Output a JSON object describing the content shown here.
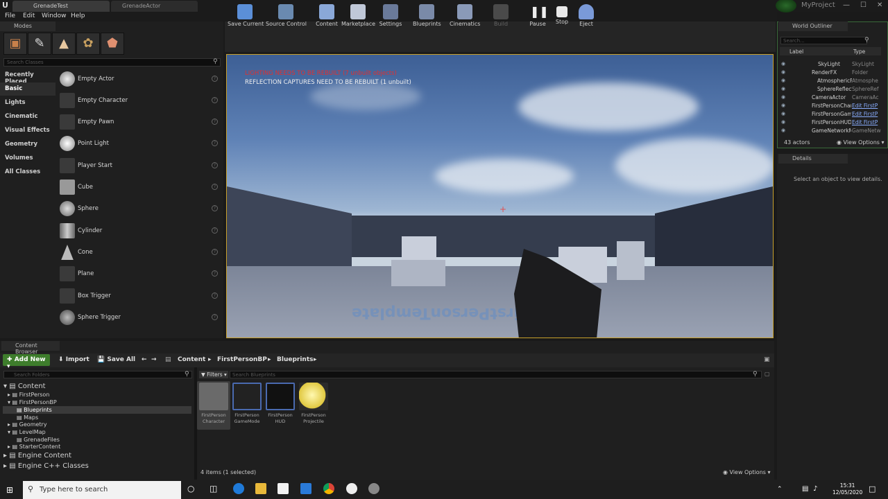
{
  "titlebar": {
    "tabs": [
      "GrenadeTest",
      "GrenadeActor"
    ],
    "project": "MyProject",
    "controls": [
      "—",
      "☐",
      "✕"
    ]
  },
  "menu": [
    "File",
    "Edit",
    "Window",
    "Help"
  ],
  "modes": {
    "header": "Modes",
    "search_placeholder": "Search Classes",
    "categories": [
      "Recently Placed",
      "Basic",
      "Lights",
      "Cinematic",
      "Visual Effects",
      "Geometry",
      "Volumes",
      "All Classes"
    ],
    "selected_category": "Basic",
    "actors": [
      "Empty Actor",
      "Empty Character",
      "Empty Pawn",
      "Point Light",
      "Player Start",
      "Cube",
      "Sphere",
      "Cylinder",
      "Cone",
      "Plane",
      "Box Trigger",
      "Sphere Trigger"
    ]
  },
  "toolbar": {
    "buttons": [
      "Save Current",
      "Source Control",
      "Content",
      "Marketplace",
      "Settings",
      "Blueprints",
      "Cinematics",
      "Build",
      "Pause",
      "Stop",
      "Eject"
    ]
  },
  "viewport": {
    "warning_lighting": "LIGHTING NEEDS TO BE REBUILT (7 unbuilt objects)",
    "warning_reflection": "REFLECTION CAPTURES NEED TO BE REBUILT (1 unbuilt)",
    "floor_text": "FirstPersonTemplate"
  },
  "outliner": {
    "header": "World Outliner",
    "search_placeholder": "Search...",
    "col_label": "Label",
    "col_type": "Type",
    "rows": [
      {
        "name": "SkyLight",
        "type": "SkyLight",
        "link": false
      },
      {
        "name": "RenderFX",
        "type": "Folder",
        "link": false
      },
      {
        "name": "AtmosphericFog",
        "type": "Atmosphe",
        "link": false
      },
      {
        "name": "SphereReflection",
        "type": "SphereRef",
        "link": false
      },
      {
        "name": "CameraActor",
        "type": "CameraAc",
        "link": false
      },
      {
        "name": "FirstPersonCharacter",
        "type": "Edit FirstP",
        "link": true
      },
      {
        "name": "FirstPersonGameMode",
        "type": "Edit FirstP",
        "link": true
      },
      {
        "name": "FirstPersonHUD",
        "type": "Edit FirstP",
        "link": true
      },
      {
        "name": "GameNetworkManager",
        "type": "GameNetw",
        "link": false
      }
    ],
    "count": "43 actors",
    "view_options": "View Options"
  },
  "details": {
    "header": "Details",
    "empty_text": "Select an object to view details."
  },
  "content_browser": {
    "header": "Content Browser",
    "add_new": "Add New",
    "import": "Import",
    "save_all": "Save All",
    "breadcrumb": [
      "Content",
      "FirstPersonBP",
      "Blueprints"
    ],
    "folder_search": "Search Folders",
    "filters": "Filters",
    "asset_search": "Search Blueprints",
    "tree": [
      {
        "label": "Content",
        "big": true
      },
      {
        "label": "FirstPerson",
        "big": false
      },
      {
        "label": "FirstPersonBP",
        "big": false
      },
      {
        "label": "Blueprints",
        "big": false
      },
      {
        "label": "Maps",
        "big": false
      },
      {
        "label": "Geometry",
        "big": false
      },
      {
        "label": "LevelMap",
        "big": false
      },
      {
        "label": "GrenadeFiles",
        "big": false
      },
      {
        "label": "StarterContent",
        "big": false
      },
      {
        "label": "Engine Content",
        "big": true
      },
      {
        "label": "Engine C++ Classes",
        "big": true
      }
    ],
    "assets": [
      {
        "line1": "FirstPerson",
        "line2": "Character"
      },
      {
        "line1": "FirstPerson",
        "line2": "GameMode"
      },
      {
        "line1": "FirstPerson",
        "line2": "HUD"
      },
      {
        "line1": "FirstPerson",
        "line2": "Projectile"
      }
    ],
    "status": "4 items (1 selected)",
    "view_options": "View Options"
  },
  "taskbar": {
    "search": "Type here to search",
    "time": "15:31",
    "date": "12/05/2020"
  }
}
